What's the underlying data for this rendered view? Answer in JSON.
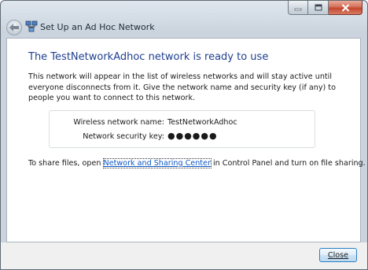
{
  "window": {
    "title": "Set Up an Ad Hoc Network"
  },
  "content": {
    "heading": "The TestNetworkAdhoc network is ready to use",
    "paragraph": "This network will appear in the list of wireless networks and will stay active until everyone disconnects from it. Give the network name and security key (if any) to people you want to connect to this network.",
    "info": {
      "name_label": "Wireless network name:",
      "name_value": "TestNetworkAdhoc",
      "key_label": "Network security key:",
      "key_value": "●●●●●●"
    },
    "share": {
      "prefix": "To share files, open",
      "link": "Network and Sharing Center",
      "suffix": "in Control Panel and turn on file sharing."
    }
  },
  "footer": {
    "close_label": "Close"
  },
  "colors": {
    "heading": "#1f3f8f",
    "link": "#0b57c4",
    "close_caption": "#c3462d"
  },
  "icons": [
    "back-arrow-icon",
    "network-icon",
    "minimize-icon",
    "maximize-icon",
    "close-icon"
  ]
}
